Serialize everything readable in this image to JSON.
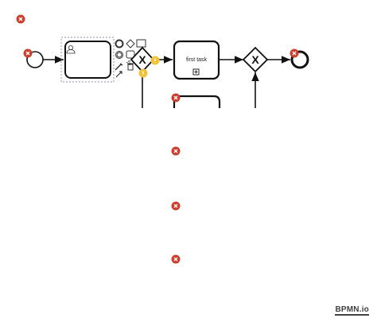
{
  "canvas": {
    "tasks": [
      {
        "id": "task-1",
        "label": ""
      },
      {
        "id": "task-2",
        "label": "first task",
        "marker": "⊞"
      },
      {
        "id": "task-3",
        "label": ""
      }
    ],
    "gateway_markers": [
      "X",
      "X"
    ]
  },
  "palette_icons": [
    "end-event-icon",
    "gateway-icon",
    "text-annotation-icon",
    "intermediate-event-icon",
    "task-icon",
    "connect-icon",
    "wrench-icon",
    "delete-icon",
    "append-icon"
  ],
  "badges": {
    "error_icon": "error-badge-icon",
    "warning_icon": "warning-badge-icon",
    "error_color": "#cc3e2d",
    "warning_color": "#f2c23b"
  },
  "logo": {
    "text": "BPMN.io"
  }
}
